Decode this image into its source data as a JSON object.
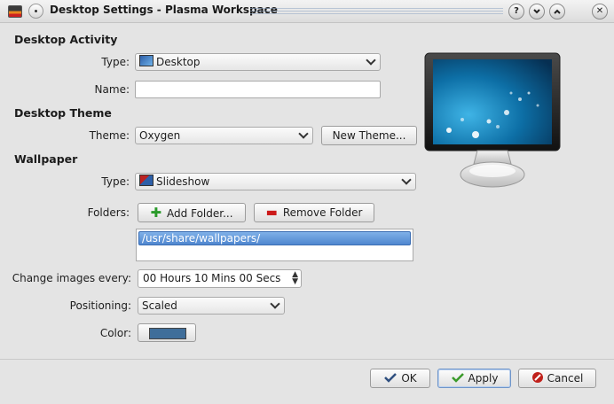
{
  "window": {
    "title": "Desktop Settings - Plasma Workspace",
    "help_button": "?",
    "minimize_button": "⌄",
    "maximize_button": "⌃",
    "close_button": "✕"
  },
  "desktop_activity": {
    "heading": "Desktop Activity",
    "type_label": "Type:",
    "type_value": "Desktop",
    "name_label": "Name:",
    "name_value": ""
  },
  "desktop_theme": {
    "heading": "Desktop Theme",
    "theme_label": "Theme:",
    "theme_value": "Oxygen",
    "new_theme_button": "New Theme..."
  },
  "wallpaper": {
    "heading": "Wallpaper",
    "type_label": "Type:",
    "type_value": "Slideshow",
    "folders_label": "Folders:",
    "add_folder_button": "Add Folder...",
    "remove_folder_button": "Remove Folder",
    "folders": [
      "/usr/share/wallpapers/"
    ],
    "change_label": "Change images every:",
    "change_value": "00 Hours 10 Mins 00 Secs",
    "positioning_label": "Positioning:",
    "positioning_value": "Scaled",
    "color_label": "Color:",
    "color_value": "#3f6e9a"
  },
  "buttons": {
    "ok": "OK",
    "apply": "Apply",
    "cancel": "Cancel"
  },
  "colors": {
    "ok_icon": "#2f4f7f",
    "apply_icon": "#3a9a2a",
    "cancel_icon": "#c0201a",
    "add_icon": "#2a9a2a",
    "remove_icon": "#cc1a1a"
  }
}
